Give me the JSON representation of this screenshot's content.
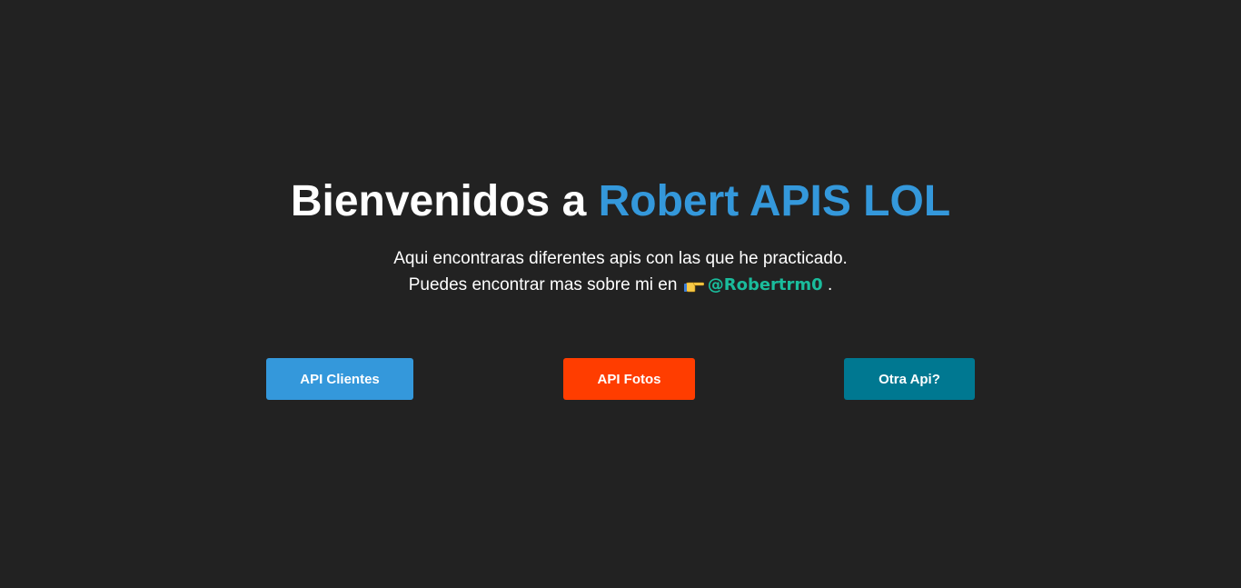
{
  "hero": {
    "title_prefix": "Bienvenidos a ",
    "title_accent": "Robert APIS LOL",
    "line1": "Aqui encontraras diferentes apis con las que he practicado.",
    "line2_prefix": "Puedes encontrar mas sobre mi en ",
    "emoji_icon": "pointing-right-hand",
    "handle": "@Robertrm0",
    "line2_suffix": " ."
  },
  "buttons": {
    "clientes": "API Clientes",
    "fotos": "API Fotos",
    "otra": "Otra Api?"
  },
  "colors": {
    "background": "#222222",
    "accent_blue": "#3498db",
    "handle_green": "#1abc9c",
    "button_orange": "#ff3d00",
    "button_teal": "#007891"
  }
}
